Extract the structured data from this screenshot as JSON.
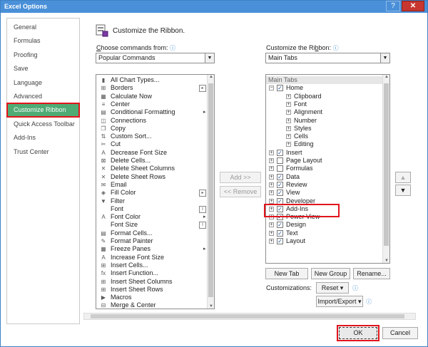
{
  "window": {
    "title": "Excel Options",
    "help": "?",
    "close": "✕"
  },
  "nav": {
    "items": [
      "General",
      "Formulas",
      "Proofing",
      "Save",
      "Language",
      "Advanced",
      "Customize Ribbon",
      "Quick Access Toolbar",
      "Add-Ins",
      "Trust Center"
    ],
    "selected": "Customize Ribbon"
  },
  "header": {
    "title": "Customize the Ribbon."
  },
  "left": {
    "label": "Choose commands from:",
    "label_accel": "C",
    "info": "ⓘ",
    "dropdown_value": "Popular Commands",
    "commands": [
      {
        "label": "All Chart Types...",
        "icon": "chart-icon",
        "glyph": "▮"
      },
      {
        "label": "Borders",
        "icon": "borders-icon",
        "glyph": "⊞",
        "arrow": "submenu-box-icon"
      },
      {
        "label": "Calculate Now",
        "icon": "calculator-icon",
        "glyph": "▦"
      },
      {
        "label": "Center",
        "icon": "center-align-icon",
        "glyph": "≡"
      },
      {
        "label": "Conditional Formatting",
        "icon": "conditional-formatting-icon",
        "glyph": "▤",
        "arrow": "submenu-arrow-icon"
      },
      {
        "label": "Connections",
        "icon": "connections-icon",
        "glyph": "◫"
      },
      {
        "label": "Copy",
        "icon": "copy-icon",
        "glyph": "❐"
      },
      {
        "label": "Custom Sort...",
        "icon": "sort-icon",
        "glyph": "⇅"
      },
      {
        "label": "Cut",
        "icon": "scissors-icon",
        "glyph": "✂"
      },
      {
        "label": "Decrease Font Size",
        "icon": "decrease-font-icon",
        "glyph": "A"
      },
      {
        "label": "Delete Cells...",
        "icon": "delete-cells-icon",
        "glyph": "⊠"
      },
      {
        "label": "Delete Sheet Columns",
        "icon": "delete-columns-icon",
        "glyph": "✕"
      },
      {
        "label": "Delete Sheet Rows",
        "icon": "delete-rows-icon",
        "glyph": "✕"
      },
      {
        "label": "Email",
        "icon": "email-icon",
        "glyph": "✉"
      },
      {
        "label": "Fill Color",
        "icon": "fill-color-icon",
        "glyph": "◈",
        "arrow": "submenu-box-icon"
      },
      {
        "label": "Filter",
        "icon": "filter-icon",
        "glyph": "▼"
      },
      {
        "label": "Font",
        "icon": "font-icon",
        "glyph": " ",
        "arrow": "font-field-icon"
      },
      {
        "label": "Font Color",
        "icon": "font-color-icon",
        "glyph": "A",
        "arrow": "submenu-arrow-icon"
      },
      {
        "label": "Font Size",
        "icon": "font-size-icon",
        "glyph": " ",
        "arrow": "font-field-icon"
      },
      {
        "label": "Format Cells...",
        "icon": "format-cells-icon",
        "glyph": "▤"
      },
      {
        "label": "Format Painter",
        "icon": "format-painter-icon",
        "glyph": "✎"
      },
      {
        "label": "Freeze Panes",
        "icon": "freeze-panes-icon",
        "glyph": "▦",
        "arrow": "submenu-arrow-icon"
      },
      {
        "label": "Increase Font Size",
        "icon": "increase-font-icon",
        "glyph": "A"
      },
      {
        "label": "Insert Cells...",
        "icon": "insert-cells-icon",
        "glyph": "⊞"
      },
      {
        "label": "Insert Function...",
        "icon": "function-icon",
        "glyph": "fx"
      },
      {
        "label": "Insert Sheet Columns",
        "icon": "insert-columns-icon",
        "glyph": "⊞"
      },
      {
        "label": "Insert Sheet Rows",
        "icon": "insert-rows-icon",
        "glyph": "⊞"
      },
      {
        "label": "Macros",
        "icon": "macros-icon",
        "glyph": "▶"
      },
      {
        "label": "Merge & Center",
        "icon": "merge-center-icon",
        "glyph": "⊟"
      }
    ]
  },
  "middle": {
    "add": "Add >>",
    "remove": "<< Remove"
  },
  "right": {
    "label": "Customize the Ribbon:",
    "label_accel": "b",
    "info": "ⓘ",
    "dropdown_value": "Main Tabs",
    "tree": [
      {
        "label": "Main Tabs",
        "level": 0,
        "header": true
      },
      {
        "label": "Home",
        "level": 1,
        "expander": "−",
        "checked": true
      },
      {
        "label": "Clipboard",
        "level": 2,
        "expander": "+"
      },
      {
        "label": "Font",
        "level": 2,
        "expander": "+"
      },
      {
        "label": "Alignment",
        "level": 2,
        "expander": "+"
      },
      {
        "label": "Number",
        "level": 2,
        "expander": "+"
      },
      {
        "label": "Styles",
        "level": 2,
        "expander": "+"
      },
      {
        "label": "Cells",
        "level": 2,
        "expander": "+"
      },
      {
        "label": "Editing",
        "level": 2,
        "expander": "+"
      },
      {
        "label": "Insert",
        "level": 1,
        "expander": "+",
        "checked": true
      },
      {
        "label": "Page Layout",
        "level": 1,
        "expander": "+",
        "checked": false
      },
      {
        "label": "Formulas",
        "level": 1,
        "expander": "+",
        "checked": false
      },
      {
        "label": "Data",
        "level": 1,
        "expander": "+",
        "checked": true
      },
      {
        "label": "Review",
        "level": 1,
        "expander": "+",
        "checked": true
      },
      {
        "label": "View",
        "level": 1,
        "expander": "+",
        "checked": true
      },
      {
        "label": "Developer",
        "level": 1,
        "expander": "+",
        "checked": true
      },
      {
        "label": "Add-Ins",
        "level": 1,
        "expander": "+",
        "checked": true
      },
      {
        "label": "Power View",
        "level": 1,
        "expander": "+",
        "checked": true
      },
      {
        "label": "Design",
        "level": 1,
        "expander": "+",
        "checked": true
      },
      {
        "label": "Text",
        "level": 1,
        "expander": "+",
        "checked": true
      },
      {
        "label": "Layout",
        "level": 1,
        "expander": "+",
        "checked": true
      }
    ],
    "new_tab": "New Tab",
    "new_group": "New Group",
    "rename": "Rename...",
    "customizations": "Customizations:",
    "reset": "Reset ▾",
    "import_export": "Import/Export ▾",
    "info2": "ⓘ",
    "info3": "ⓘ"
  },
  "footer": {
    "ok": "OK",
    "cancel": "Cancel"
  },
  "colors": {
    "titlebar": "#4a90d9",
    "selected_nav": "#4fab74",
    "highlight": "#e2141b"
  }
}
